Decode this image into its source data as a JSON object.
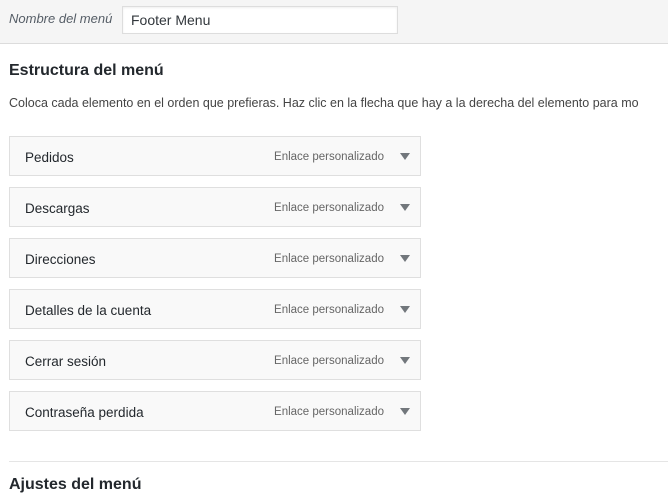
{
  "menu_name": {
    "label": "Nombre del menú",
    "value": "Footer Menu"
  },
  "structure": {
    "title": "Estructura del menú",
    "instructions": "Coloca cada elemento en el orden que prefieras. Haz clic en la flecha que hay a la derecha del elemento para mo"
  },
  "items": [
    {
      "title": "Pedidos",
      "type": "Enlace personalizado",
      "toggle_icon": "triangle-down-icon"
    },
    {
      "title": "Descargas",
      "type": "Enlace personalizado",
      "toggle_icon": "triangle-down-icon"
    },
    {
      "title": "Direcciones",
      "type": "Enlace personalizado",
      "toggle_icon": "triangle-down-icon"
    },
    {
      "title": "Detalles de la cuenta",
      "type": "Enlace personalizado",
      "toggle_icon": "triangle-down-icon"
    },
    {
      "title": "Cerrar sesión",
      "type": "Enlace personalizado",
      "toggle_icon": "triangle-down-icon"
    },
    {
      "title": "Contraseña perdida",
      "type": "Enlace personalizado",
      "toggle_icon": "triangle-down-icon"
    }
  ],
  "settings": {
    "title": "Ajustes del menú"
  },
  "colors": {
    "item_background": "#f9f9f9",
    "item_border": "#dfdfdf",
    "header_background": "#f5f5f5",
    "toggle_arrow": "#72777c"
  }
}
